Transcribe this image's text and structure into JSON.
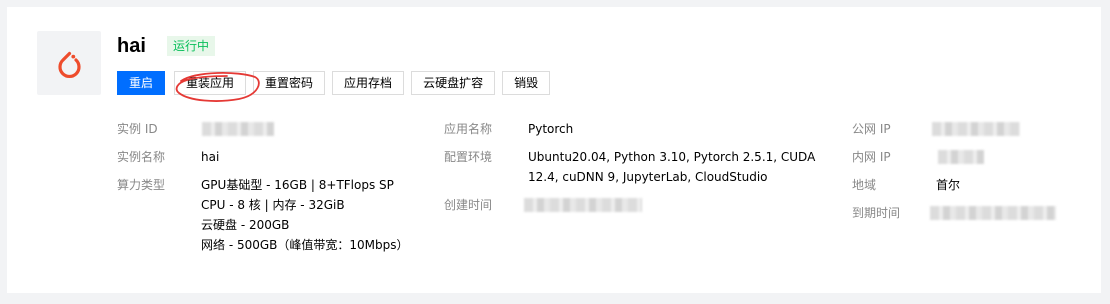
{
  "instance": {
    "name": "hai",
    "status": "运行中",
    "logo_icon": "pytorch-icon",
    "colors": {
      "brand": "#ee4c2c",
      "primary": "#006eff",
      "status": "#0abf5b"
    }
  },
  "actions": {
    "restart": "重启",
    "reinstall": "重装应用",
    "reset_password": "重置密码",
    "save_app": "应用存档",
    "expand_disk": "云硬盘扩容",
    "destroy": "销毁"
  },
  "details": {
    "col1": {
      "instance_id_label": "实例 ID",
      "instance_name_label": "实例名称",
      "instance_name_value": "hai",
      "compute_type_label": "算力类型",
      "compute_lines": [
        "GPU基础型 - 16GB | 8+TFlops SP",
        "CPU - 8 核 | 内存 - 32GiB",
        "云硬盘 - 200GB",
        "网络 - 500GB（峰值带宽：10Mbps）"
      ]
    },
    "col2": {
      "app_name_label": "应用名称",
      "app_name_value": "Pytorch",
      "env_label": "配置环境",
      "env_lines": [
        "Ubuntu20.04, Python 3.10, Pytorch 2.5.1, CUDA",
        "12.4, cuDNN 9, JupyterLab, CloudStudio"
      ],
      "created_label": "创建时间"
    },
    "col3": {
      "public_ip_label": "公网 IP",
      "private_ip_label": "内网 IP",
      "region_label": "地域",
      "region_value": "首尔",
      "expire_label": "到期时间"
    }
  }
}
